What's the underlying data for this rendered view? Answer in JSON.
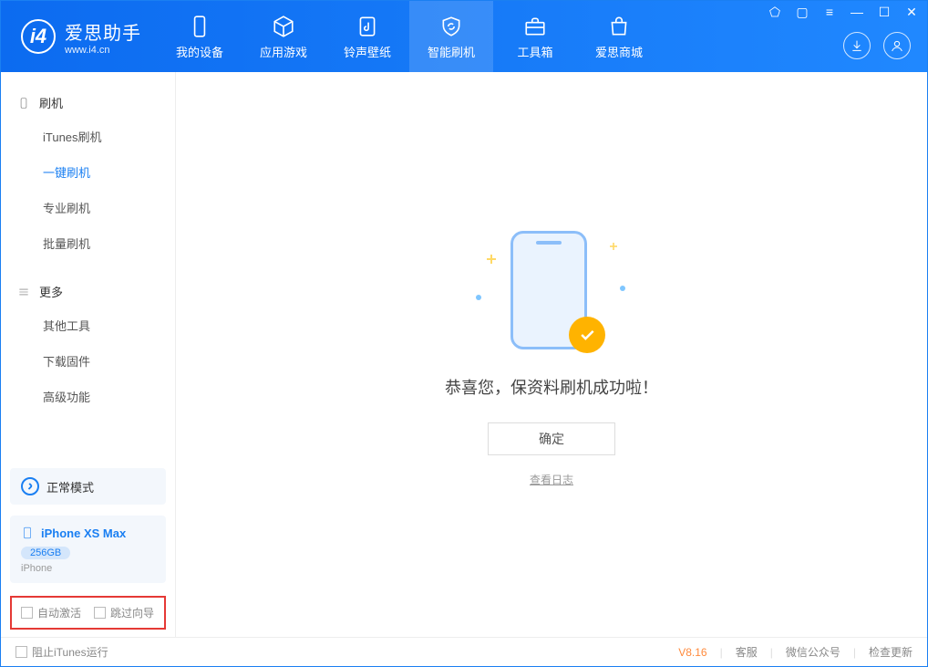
{
  "app": {
    "name": "爱思助手",
    "site": "www.i4.cn"
  },
  "titlebar": {
    "icons": [
      "hex",
      "doc",
      "menu",
      "min",
      "max",
      "close"
    ]
  },
  "tabs": [
    {
      "id": "device",
      "label": "我的设备"
    },
    {
      "id": "apps",
      "label": "应用游戏"
    },
    {
      "id": "ringtone",
      "label": "铃声壁纸"
    },
    {
      "id": "flash",
      "label": "智能刷机",
      "active": true
    },
    {
      "id": "toolbox",
      "label": "工具箱"
    },
    {
      "id": "store",
      "label": "爱思商城"
    }
  ],
  "sidebar": {
    "group1": {
      "title": "刷机",
      "items": [
        {
          "id": "itunes",
          "label": "iTunes刷机"
        },
        {
          "id": "oneclick",
          "label": "一键刷机",
          "active": true
        },
        {
          "id": "pro",
          "label": "专业刷机"
        },
        {
          "id": "batch",
          "label": "批量刷机"
        }
      ]
    },
    "group2": {
      "title": "更多",
      "items": [
        {
          "id": "other",
          "label": "其他工具"
        },
        {
          "id": "firmware",
          "label": "下载固件"
        },
        {
          "id": "advanced",
          "label": "高级功能"
        }
      ]
    },
    "mode": "正常模式",
    "device": {
      "name": "iPhone XS Max",
      "storage": "256GB",
      "type": "iPhone"
    },
    "checks": {
      "auto_activate": "自动激活",
      "skip_guide": "跳过向导"
    }
  },
  "main": {
    "success_text": "恭喜您，保资料刷机成功啦！",
    "ok": "确定",
    "view_log": "查看日志"
  },
  "footer": {
    "block_itunes": "阻止iTunes运行",
    "version": "V8.16",
    "links": {
      "service": "客服",
      "wechat": "微信公众号",
      "update": "检查更新"
    }
  }
}
